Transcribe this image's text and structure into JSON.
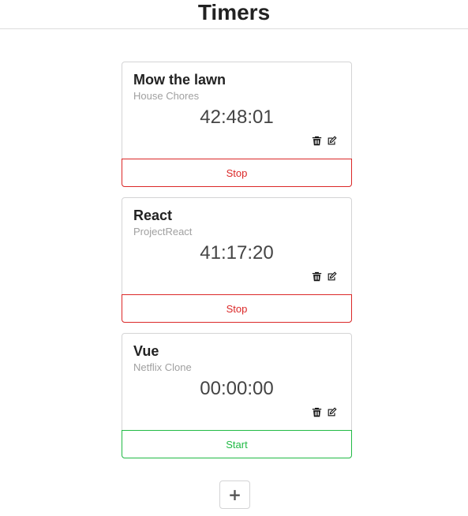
{
  "header": {
    "title": "Timers"
  },
  "timers": [
    {
      "title": "Mow the lawn",
      "project": "House Chores",
      "elapsed": "42:48:01",
      "action_label": "Stop",
      "running": true
    },
    {
      "title": "React",
      "project": "ProjectReact",
      "elapsed": "41:17:20",
      "action_label": "Stop",
      "running": true
    },
    {
      "title": "Vue",
      "project": "Netflix Clone",
      "elapsed": "00:00:00",
      "action_label": "Start",
      "running": false
    }
  ],
  "add_button": {
    "label": "+"
  },
  "icons": {
    "delete": "trash-icon",
    "edit": "edit-icon"
  },
  "colors": {
    "stop": "#db2828",
    "start": "#21ba45",
    "border": "#d4d4d5"
  }
}
